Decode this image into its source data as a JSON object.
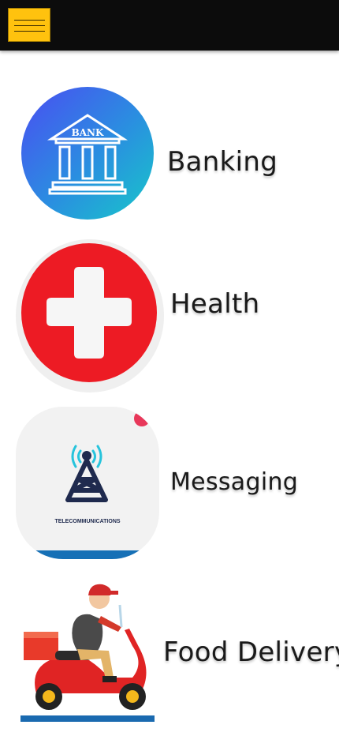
{
  "header": {
    "menu_icon": "hamburger-menu-icon",
    "menu_color": "#ffc20e",
    "background": "#0c0c0c"
  },
  "services": [
    {
      "label": "Banking",
      "icon": "bank-icon",
      "icon_text": "BANK"
    },
    {
      "label": "Health",
      "icon": "medical-cross-icon"
    },
    {
      "label": "Messaging",
      "icon": "telecom-tower-icon",
      "icon_text": "TELECOMMUNICATIONS"
    },
    {
      "label": "Food Delivery",
      "icon": "delivery-scooter-icon"
    }
  ]
}
